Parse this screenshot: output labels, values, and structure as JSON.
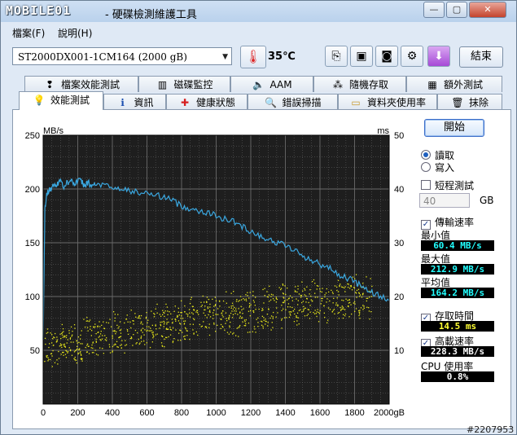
{
  "window": {
    "brand": "MOBILE01",
    "title": "- 硬碟檢測維護工具",
    "buttons": {
      "minimize": "—",
      "maximize": "▢",
      "close": "✕"
    }
  },
  "menu": [
    {
      "label": "檔案(F)"
    },
    {
      "label": "說明(H)"
    }
  ],
  "toolbar": {
    "drive": "ST2000DX001-1CM164 (2000 gB)",
    "temperature": "35℃",
    "exit_label": "結束",
    "icons": [
      "copy-text-icon",
      "copy-image-icon",
      "screenshot-camera-icon",
      "settings-wrench-icon",
      "download-arrow-icon"
    ]
  },
  "tabs_row1": [
    {
      "label": "檔案效能測試",
      "icon": "file-benchmark-icon"
    },
    {
      "label": "磁碟監控",
      "icon": "disk-monitor-icon"
    },
    {
      "label": "AAM",
      "icon": "speaker-icon"
    },
    {
      "label": "隨機存取",
      "icon": "random-access-icon"
    },
    {
      "label": "額外測試",
      "icon": "extra-tests-icon"
    }
  ],
  "tabs_row2": [
    {
      "label": "效能測試",
      "icon": "bulb-icon",
      "active": true
    },
    {
      "label": "資訊",
      "icon": "info-icon"
    },
    {
      "label": "健康狀態",
      "icon": "health-cross-icon"
    },
    {
      "label": "錯誤掃描",
      "icon": "magnifier-icon"
    },
    {
      "label": "資料夾使用率",
      "icon": "folder-icon"
    },
    {
      "label": "抹除",
      "icon": "trash-icon"
    }
  ],
  "side": {
    "start_label": "開始",
    "read_label": "讀取",
    "write_label": "寫入",
    "mode_selected": "讀取",
    "short_test_label": "短程測試",
    "short_test_checked": false,
    "short_test_value": "40",
    "short_test_unit": "GB",
    "transfer_label": "傳輸速率",
    "transfer_checked": true,
    "min_label": "最小值",
    "min_value": "60.4 MB/s",
    "max_label": "最大值",
    "max_value": "212.9 MB/s",
    "avg_label": "平均值",
    "avg_value": "164.2 MB/s",
    "access_label": "存取時間",
    "access_checked": true,
    "access_value": "14.5 ms",
    "burst_label": "高載速率",
    "burst_checked": true,
    "burst_value": "228.3 MB/s",
    "cpu_label": "CPU 使用率",
    "cpu_value": "0.8%"
  },
  "watermark": "#2207953",
  "chart_data": {
    "type": "line",
    "y_left_label": "MB/s",
    "y_right_label": "ms",
    "x_unit": "gB",
    "xlim": [
      0,
      2000
    ],
    "ylim_left": [
      0,
      250
    ],
    "ylim_right": [
      0,
      50
    ],
    "x_ticks": [
      "0",
      "200",
      "400",
      "600",
      "800",
      "1000",
      "1200",
      "1400",
      "1600",
      "1800",
      "2000gB"
    ],
    "y_left_ticks": [
      "50",
      "100",
      "150",
      "200",
      "250"
    ],
    "y_right_ticks": [
      "10",
      "20",
      "30",
      "40",
      "50"
    ],
    "grid": true,
    "colors": {
      "background": "#1e1e1e",
      "grid": "#6a6a6a",
      "transfer": "#3aa7e0",
      "access": "#e8e81a"
    },
    "series": [
      {
        "name": "傳輸速率",
        "axis": "left",
        "x": [
          0,
          10,
          20,
          40,
          60,
          80,
          100,
          120,
          140,
          160,
          180,
          200,
          220,
          240,
          260,
          280,
          300,
          350,
          400,
          450,
          500,
          550,
          600,
          650,
          700,
          750,
          800,
          850,
          900,
          950,
          1000,
          1050,
          1100,
          1150,
          1200,
          1250,
          1300,
          1350,
          1400,
          1450,
          1500,
          1550,
          1600,
          1650,
          1700,
          1750,
          1800,
          1850,
          1900,
          1950,
          2000
        ],
        "y": [
          60,
          180,
          195,
          200,
          203,
          205,
          208,
          201,
          206,
          210,
          204,
          208,
          207,
          203,
          206,
          202,
          205,
          203,
          201,
          200,
          198,
          197,
          196,
          194,
          193,
          189,
          184,
          182,
          180,
          178,
          175,
          172,
          170,
          165,
          161,
          157,
          153,
          150,
          148,
          143,
          138,
          134,
          130,
          127,
          121,
          118,
          114,
          108,
          104,
          100,
          96
        ]
      },
      {
        "name": "存取時間",
        "axis": "right",
        "trend": {
          "x": [
            0,
            500,
            1000,
            1500,
            2000
          ],
          "y": [
            10.5,
            13.5,
            16.5,
            19,
            20.5
          ]
        },
        "spread": 3.8,
        "x_range": [
          0,
          1900
        ],
        "count": 950
      }
    ]
  }
}
